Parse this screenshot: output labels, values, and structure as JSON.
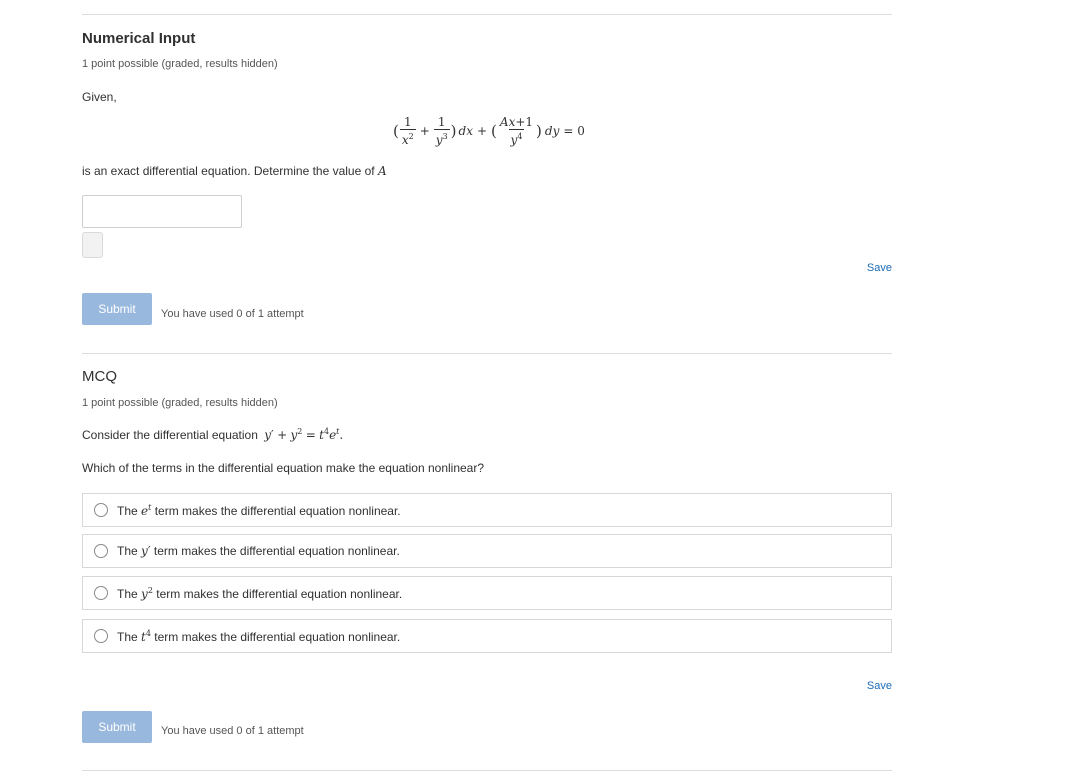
{
  "q1": {
    "title": "Numerical Input",
    "points": "1 point possible (graded, results hidden)",
    "given": "Given,",
    "equation": {
      "open1": "(",
      "f1_num": "1",
      "f1_den_var": "x",
      "f1_den_exp": "2",
      "plus1": "+",
      "f2_num": "1",
      "f2_den_var": "y",
      "f2_den_exp": "3",
      "close1": ")",
      "dx": "dx",
      "plus2": "+",
      "open2": "(",
      "f3_num_a": "Ax",
      "f3_num_b": "+1",
      "f3_den_var": "y",
      "f3_den_exp": "4",
      "close2": ")",
      "dy": "dy",
      "rhs": "= 0"
    },
    "prompt": "is an exact differential equation. Determine the value of",
    "prompt_var": "A",
    "save_label": "Save",
    "submit_label": "Submit",
    "attempts": "You have used 0 of 1 attempt"
  },
  "q2": {
    "title": "MCQ",
    "points": "1 point possible (graded, results hidden)",
    "consider_prefix": "Consider the differential equation",
    "consider_eq": {
      "y1": "y",
      "prime": "′",
      "plus": "+",
      "y2": "y",
      "exp2": "2",
      "eq": "=",
      "t": "t",
      "exp4": "4",
      "e": "e",
      "expt": "t",
      "dot": "."
    },
    "question": "Which of the terms in the differential equation make the equation nonlinear?",
    "options": [
      {
        "prefix": "The",
        "var": "e",
        "sup": "t",
        "suffix": "term makes the differential equation nonlinear."
      },
      {
        "prefix": "The",
        "var": "y",
        "sup": "′",
        "suffix": "term makes the differential equation nonlinear."
      },
      {
        "prefix": "The",
        "var": "y",
        "sup": "2",
        "suffix": "term makes the differential equation nonlinear."
      },
      {
        "prefix": "The",
        "var": "t",
        "sup": "4",
        "suffix": "term makes the differential equation nonlinear."
      }
    ],
    "save_label": "Save",
    "submit_label": "Submit",
    "attempts": "You have used 0 of 1 attempt"
  }
}
